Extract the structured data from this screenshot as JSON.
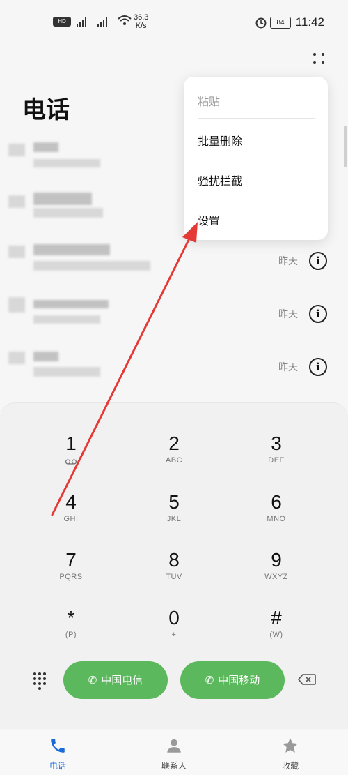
{
  "status_bar": {
    "network_speed": "36.3",
    "speed_unit": "K/s",
    "battery": "84",
    "time": "11:42"
  },
  "header": {
    "title": "电话"
  },
  "menu": {
    "items": [
      {
        "label": "粘贴",
        "disabled": true
      },
      {
        "label": "批量删除",
        "disabled": false
      },
      {
        "label": "骚扰拦截",
        "disabled": false
      },
      {
        "label": "设置",
        "disabled": false
      }
    ]
  },
  "call_log": [
    {
      "when": ""
    },
    {
      "when": ""
    },
    {
      "when": "昨天"
    },
    {
      "when": "昨天"
    },
    {
      "when": "昨天"
    }
  ],
  "keypad": {
    "keys": [
      {
        "digit": "1",
        "letters": ""
      },
      {
        "digit": "2",
        "letters": "ABC"
      },
      {
        "digit": "3",
        "letters": "DEF"
      },
      {
        "digit": "4",
        "letters": "GHI"
      },
      {
        "digit": "5",
        "letters": "JKL"
      },
      {
        "digit": "6",
        "letters": "MNO"
      },
      {
        "digit": "7",
        "letters": "PQRS"
      },
      {
        "digit": "8",
        "letters": "TUV"
      },
      {
        "digit": "9",
        "letters": "WXYZ"
      },
      {
        "digit": "*",
        "letters": "(P)"
      },
      {
        "digit": "0",
        "letters": "+"
      },
      {
        "digit": "#",
        "letters": "(W)"
      }
    ],
    "call_buttons": [
      {
        "label": "中国电信",
        "color": "#5cb85c"
      },
      {
        "label": "中国移动",
        "color": "#5cb85c"
      }
    ]
  },
  "bottom_nav": {
    "items": [
      {
        "label": "电话",
        "active": true
      },
      {
        "label": "联系人",
        "active": false
      },
      {
        "label": "收藏",
        "active": false
      }
    ]
  },
  "accent_color": "#1a6ad8",
  "annotation_color": "#e53935"
}
